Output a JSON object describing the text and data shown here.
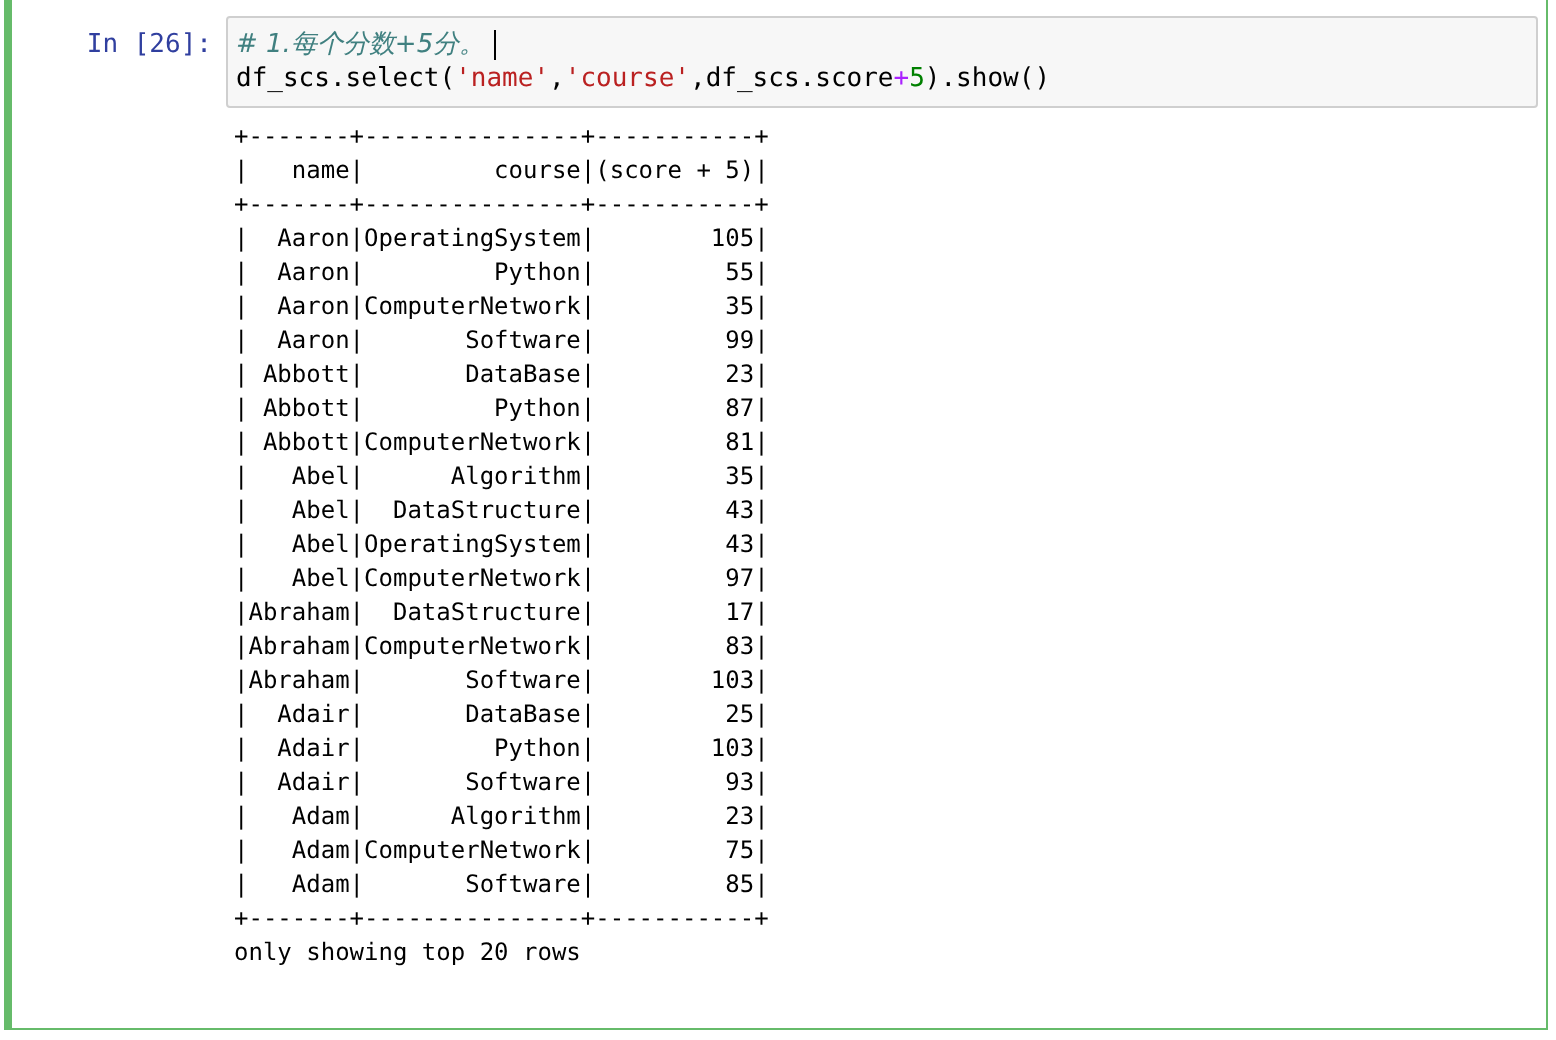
{
  "cell": {
    "prompt": "In [26]:",
    "edit_mode": true,
    "input_lines": [
      [
        {
          "kind": "comment",
          "text": "# 1.每个分数+5分。"
        }
      ],
      [
        {
          "kind": "plain",
          "text": "df_scs.select("
        },
        {
          "kind": "string",
          "text": "'name'"
        },
        {
          "kind": "plain",
          "text": ","
        },
        {
          "kind": "string",
          "text": "'course'"
        },
        {
          "kind": "plain",
          "text": ",df_scs.score"
        },
        {
          "kind": "operator",
          "text": "+"
        },
        {
          "kind": "number",
          "text": "5"
        },
        {
          "kind": "plain",
          "text": ").show()"
        }
      ]
    ],
    "output_lines": [
      "+-------+---------------+-----------+",
      "|   name|         course|(score + 5)|",
      "+-------+---------------+-----------+",
      "|  Aaron|OperatingSystem|        105|",
      "|  Aaron|         Python|         55|",
      "|  Aaron|ComputerNetwork|         35|",
      "|  Aaron|       Software|         99|",
      "| Abbott|       DataBase|         23|",
      "| Abbott|         Python|         87|",
      "| Abbott|ComputerNetwork|         81|",
      "|   Abel|      Algorithm|         35|",
      "|   Abel|  DataStructure|         43|",
      "|   Abel|OperatingSystem|         43|",
      "|   Abel|ComputerNetwork|         97|",
      "|Abraham|  DataStructure|         17|",
      "|Abraham|ComputerNetwork|         83|",
      "|Abraham|       Software|        103|",
      "|  Adair|       DataBase|         25|",
      "|  Adair|         Python|        103|",
      "|  Adair|       Software|         93|",
      "|   Adam|      Algorithm|         23|",
      "|   Adam|ComputerNetwork|         75|",
      "|   Adam|       Software|         85|",
      "+-------+---------------+-----------+",
      "only showing top 20 rows"
    ]
  }
}
